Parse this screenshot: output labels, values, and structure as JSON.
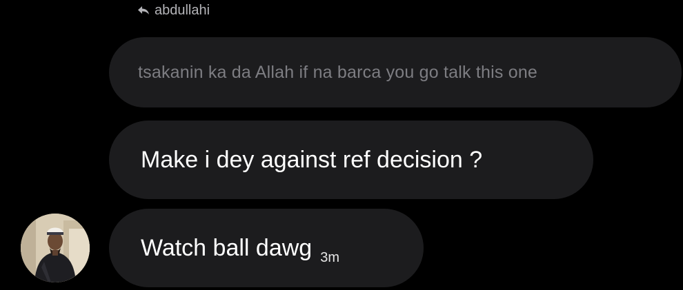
{
  "reply_header": {
    "icon": "reply-arrow-icon",
    "username": "abdullahi"
  },
  "quoted_message": {
    "text": "tsakanin ka da Allah if na barca you go talk this one"
  },
  "messages": [
    {
      "text": "Make i dey against ref decision ?"
    },
    {
      "text": "Watch ball dawg",
      "timestamp": "3m"
    }
  ],
  "avatar": {
    "icon": "user-avatar"
  },
  "colors": {
    "background": "#000000",
    "bubble": "#1c1c1e",
    "quoted_text": "#7d7d82",
    "header_text": "#b4b4b8",
    "message_text": "#ffffff"
  }
}
